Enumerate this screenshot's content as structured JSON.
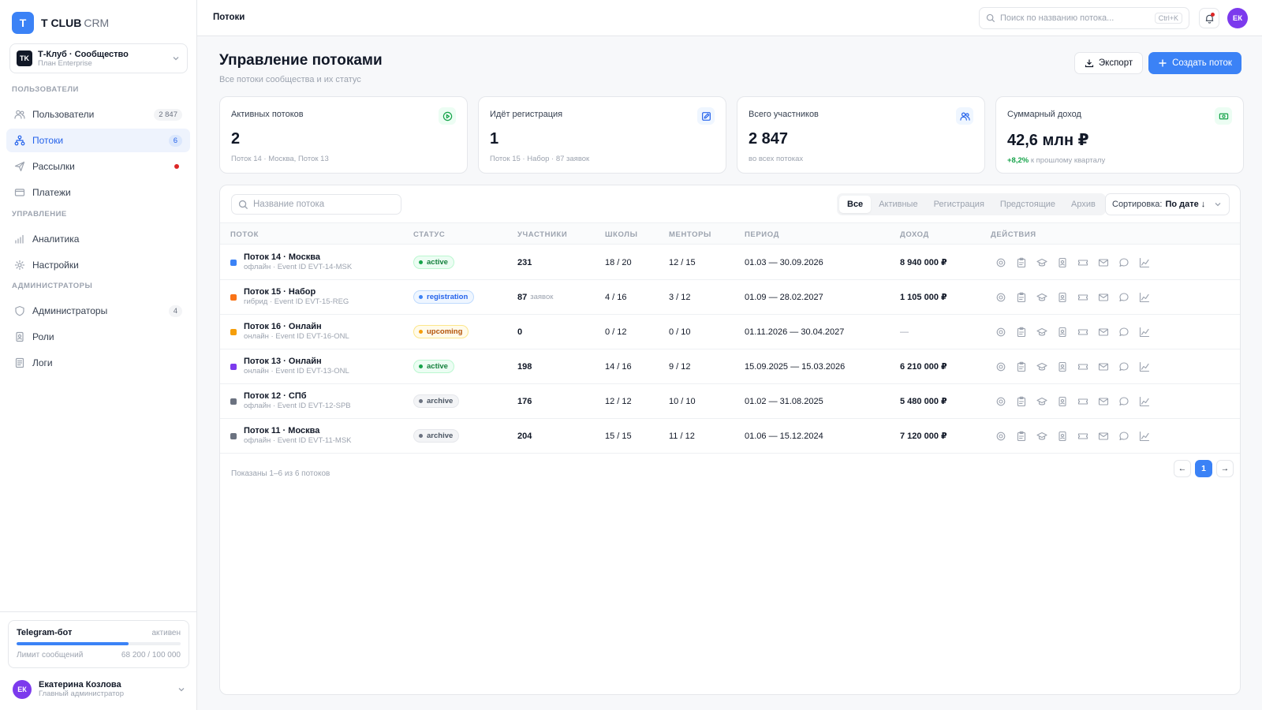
{
  "brand": {
    "logo_letter": "T",
    "name": "T CLUB",
    "suffix": "CRM"
  },
  "org": {
    "logo": "TK",
    "name": "Т-Клуб · Сообщество",
    "plan": "План Enterprise"
  },
  "sidebar": {
    "sections": [
      {
        "label": "ПОЛЬЗОВАТЕЛИ",
        "items": [
          {
            "label": "Пользователи",
            "icon": "users-icon",
            "badge": "2 847",
            "active": false
          },
          {
            "label": "Потоки",
            "icon": "streams-icon",
            "badge": "6",
            "active": true
          },
          {
            "label": "Рассылки",
            "icon": "send-icon",
            "badge": "",
            "dot": true,
            "active": false
          },
          {
            "label": "Платежи",
            "icon": "card-icon",
            "badge": "",
            "active": false
          }
        ]
      },
      {
        "label": "УПРАВЛЕНИЕ",
        "items": [
          {
            "label": "Аналитика",
            "icon": "analytics-icon",
            "badge": "",
            "active": false
          },
          {
            "label": "Настройки",
            "icon": "gear-icon",
            "badge": "",
            "active": false
          }
        ]
      },
      {
        "label": "АДМИНИСТРАТОРЫ",
        "items": [
          {
            "label": "Администраторы",
            "icon": "shield-icon",
            "badge": "4",
            "active": false
          },
          {
            "label": "Роли",
            "icon": "badge-icon",
            "badge": "",
            "active": false
          },
          {
            "label": "Логи",
            "icon": "log-icon",
            "badge": "",
            "active": false
          }
        ]
      }
    ]
  },
  "bot": {
    "title": "Telegram-бот",
    "status": "активен",
    "limit_label": "Лимит сообщений",
    "limit_value": "68 200 / 100 000",
    "usage_fraction": 0.682
  },
  "user": {
    "initials": "ЕК",
    "name": "Екатерина Козлова",
    "role": "Главный администратор"
  },
  "topbar": {
    "breadcrumb": "Потоки",
    "search_placeholder": "Поиск по названию потока...",
    "shortcut": "Ctrl+K",
    "avatar": "ЕК"
  },
  "header": {
    "title": "Управление потоками",
    "subtitle": "Все потоки сообщества и их статус",
    "export_label": "Экспорт",
    "create_label": "Создать поток"
  },
  "stats": [
    {
      "label": "Активных потоков",
      "value": "2",
      "note": "Поток 14 · Москва, Поток 13",
      "icon": "play-circle-icon",
      "color": "#16a34a",
      "bg": "#ecfdf3"
    },
    {
      "label": "Идёт регистрация",
      "value": "1",
      "note": "Поток 15 · Набор · 87 заявок",
      "icon": "edit-icon",
      "color": "#2563eb",
      "bg": "#eff6ff"
    },
    {
      "label": "Всего участников",
      "value": "2 847",
      "note": "во всех потоках",
      "icon": "users-icon",
      "color": "#2563eb",
      "bg": "#eff6ff"
    },
    {
      "label": "Суммарный доход",
      "value": "42,6 млн ₽",
      "note_positive": "+8,2%",
      "note": "к прошлому кварталу",
      "icon": "cash-icon",
      "color": "#16a34a",
      "bg": "#ecfdf3"
    }
  ],
  "table": {
    "search_placeholder": "Название потока",
    "filters": [
      "Все",
      "Активные",
      "Регистрация",
      "Предстоящие",
      "Архив"
    ],
    "active_filter": 0,
    "sort_label": "Сортировка:",
    "sort_value": "По дате ↓",
    "columns": [
      "ПОТОК",
      "СТАТУС",
      "УЧАСТНИКИ",
      "ШКОЛЫ",
      "МЕНТОРЫ",
      "ПЕРИОД",
      "ДОХОД",
      "ДЕЙСТВИЯ"
    ],
    "rows": [
      {
        "name": "Поток 14 · Москва",
        "meta": "офлайн · Event ID EVT-14-MSK",
        "color": "#3b82f6",
        "status": "active",
        "participants": "231",
        "participants_unit": "",
        "schools": "18 / 20",
        "mentors": "12 / 15",
        "period": "01.03 — 30.09.2026",
        "income": "8 940 000 ₽"
      },
      {
        "name": "Поток 15 · Набор",
        "meta": "гибрид · Event ID EVT-15-REG",
        "color": "#f97316",
        "status": "registration",
        "participants": "87",
        "participants_unit": "заявок",
        "schools": "4 / 16",
        "mentors": "3 / 12",
        "period": "01.09 — 28.02.2027",
        "income": "1 105 000 ₽"
      },
      {
        "name": "Поток 16 · Онлайн",
        "meta": "онлайн · Event ID EVT-16-ONL",
        "color": "#f59e0b",
        "status": "upcoming",
        "participants": "0",
        "participants_unit": "",
        "schools": "0 / 12",
        "mentors": "0 / 10",
        "period": "01.11.2026 — 30.04.2027",
        "income": "—"
      },
      {
        "name": "Поток 13 · Онлайн",
        "meta": "онлайн · Event ID EVT-13-ONL",
        "color": "#7c3aed",
        "status": "active",
        "participants": "198",
        "participants_unit": "",
        "schools": "14 / 16",
        "mentors": "9 / 12",
        "period": "15.09.2025 — 15.03.2026",
        "income": "6 210 000 ₽"
      },
      {
        "name": "Поток 12 · СПб",
        "meta": "офлайн · Event ID EVT-12-SPB",
        "color": "#6b7280",
        "status": "archive",
        "participants": "176",
        "participants_unit": "",
        "schools": "12 / 12",
        "mentors": "10 / 10",
        "period": "01.02 — 31.08.2025",
        "income": "5 480 000 ₽"
      },
      {
        "name": "Поток 11 · Москва",
        "meta": "офлайн · Event ID EVT-11-MSK",
        "color": "#6b7280",
        "status": "archive",
        "participants": "204",
        "participants_unit": "",
        "schools": "15 / 15",
        "mentors": "11 / 12",
        "period": "01.06 — 15.12.2024",
        "income": "7 120 000 ₽"
      }
    ],
    "row_actions": [
      "settings-icon",
      "clipboard-icon",
      "graduation-cap-icon",
      "badge-icon",
      "ticket-icon",
      "mail-icon",
      "chat-icon",
      "chart-icon"
    ],
    "footnote": "Показаны 1–6 из 6 потоков",
    "pagination": {
      "prev": "←",
      "current": "1",
      "next": "→"
    }
  }
}
